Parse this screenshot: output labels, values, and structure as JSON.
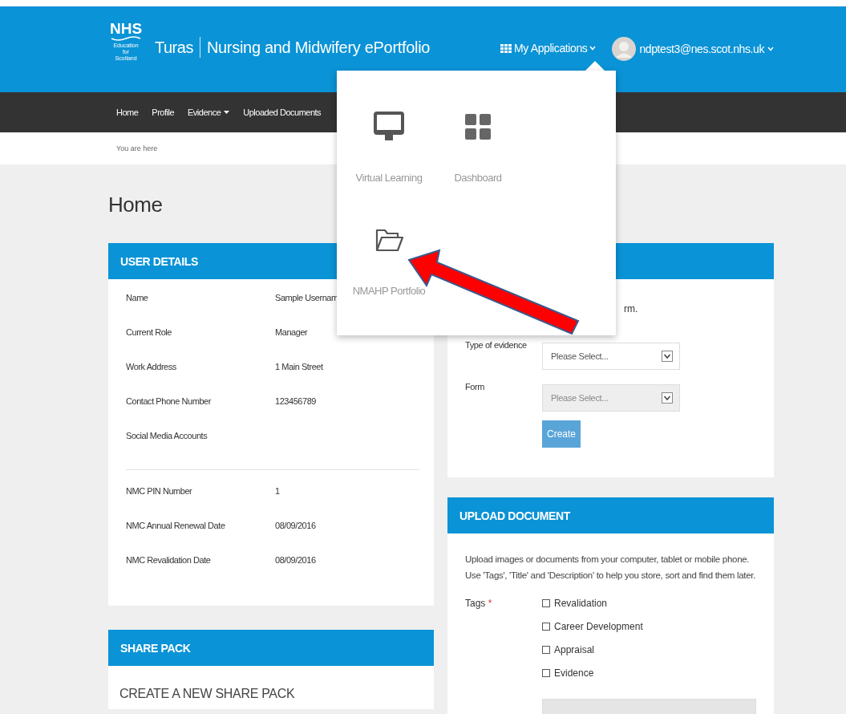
{
  "header": {
    "logo": {
      "mark": "NHS",
      "lines": [
        "Education",
        "for",
        "Scotland"
      ]
    },
    "app_name": "Turas",
    "app_title": "Nursing and Midwifery ePortfolio",
    "apps_menu": {
      "label": "My Applications"
    },
    "user": {
      "email": "ndptest3@nes.scot.nhs.uk"
    }
  },
  "nav": [
    {
      "label": "Home",
      "has_dropdown": false
    },
    {
      "label": "Profile",
      "has_dropdown": false
    },
    {
      "label": "Evidence",
      "has_dropdown": true
    },
    {
      "label": "Uploaded Documents",
      "has_dropdown": false
    }
  ],
  "breadcrumb": "You are here",
  "page_title": "Home",
  "user_details": {
    "title": "USER DETAILS",
    "groups": [
      [
        {
          "label": "Name",
          "value": "Sample Usernam"
        },
        {
          "label": "Current Role",
          "value": "Manager"
        },
        {
          "label": "Work Address",
          "value": "1 Main Street"
        },
        {
          "label": "Contact Phone Number",
          "value": "123456789"
        },
        {
          "label": "Social Media Accounts"
        }
      ],
      [
        {
          "label": "NMC PIN Number",
          "value": "1"
        },
        {
          "label": "NMC Annual Renewal Date",
          "value": "08/09/2016"
        },
        {
          "label": "NMC Revalidation Date",
          "value": "08/09/2016"
        }
      ]
    ]
  },
  "share_pack": {
    "title": "SHARE PACK",
    "subtitle": "CREATE A NEW SHARE PACK"
  },
  "evidence_panel": {
    "intro": "rm.",
    "fields": [
      {
        "label": "Type of evidence",
        "placeholder": "Please Select...",
        "disabled": false
      },
      {
        "label": "Form",
        "placeholder": "Please Select...",
        "disabled": true
      }
    ],
    "button": "Create"
  },
  "upload_document": {
    "title": "UPLOAD DOCUMENT",
    "description": [
      "Upload images or documents from your computer, tablet or mobile phone.",
      "Use 'Tags', 'Title' and 'Description' to help you store, sort and find them later."
    ],
    "tags_label": "Tags",
    "required_mark": "*",
    "tags": [
      {
        "label": "Revalidation",
        "checked": false
      },
      {
        "label": "Career Development",
        "checked": false
      },
      {
        "label": "Appraisal",
        "checked": false
      },
      {
        "label": "Evidence",
        "checked": false
      }
    ]
  },
  "apps_dropdown": [
    {
      "label": "Virtual Learning",
      "kind": "monitor"
    },
    {
      "label": "Dashboard",
      "kind": "grid"
    },
    {
      "label": "NMAHP Portfolio",
      "kind": "folder"
    }
  ]
}
